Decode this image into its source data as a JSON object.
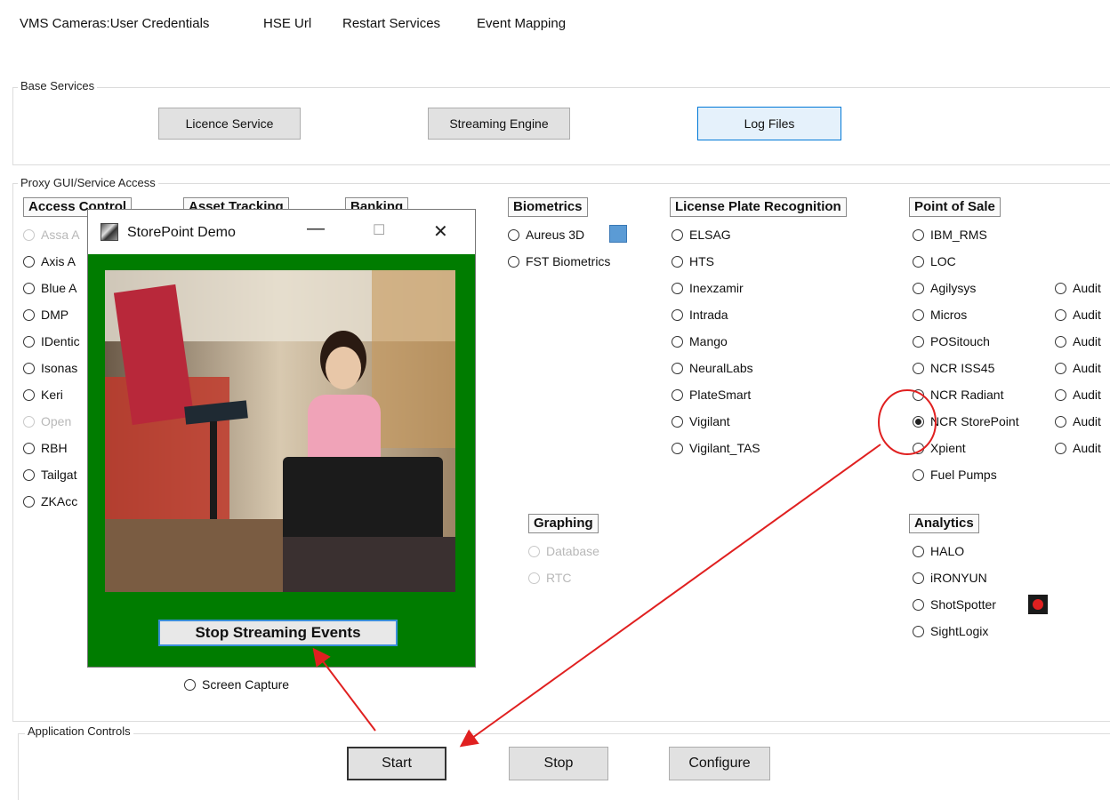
{
  "menu": [
    "VMS Cameras:User Credentials",
    "HSE Url",
    "Restart Services",
    "Event Mapping"
  ],
  "base_services": {
    "label": "Base Services",
    "buttons": [
      "Licence Service",
      "Streaming Engine",
      "Log Files"
    ]
  },
  "proxy": {
    "label": "Proxy GUI/Service Access",
    "categories": {
      "access_control": "Access Control",
      "asset_tracking": "Asset Tracking",
      "banking": "Banking",
      "biometrics": "Biometrics",
      "lpr": "License Plate Recognition",
      "pos": "Point of Sale",
      "graphing": "Graphing",
      "analytics": "Analytics"
    },
    "access_control_items": [
      "Assa A",
      "Axis A",
      "Blue A",
      "DMP",
      "IDentic",
      "Isonas",
      "Keri",
      "Open",
      "RBH",
      "Tailgat",
      "ZKAcc"
    ],
    "biometrics_items": [
      "Aureus 3D",
      "FST Biometrics"
    ],
    "lpr_items": [
      "ELSAG",
      "HTS",
      "Inexzamir",
      "Intrada",
      "Mango",
      "NeuralLabs",
      "PlateSmart",
      "Vigilant",
      "Vigilant_TAS"
    ],
    "pos_items": [
      "IBM_RMS",
      "LOC",
      "Agilysys",
      "Micros",
      "POSitouch",
      "NCR ISS45",
      "NCR Radiant",
      "NCR StorePoint",
      "Xpient",
      "Fuel Pumps"
    ],
    "pos_selected": "NCR StorePoint",
    "audit_items": [
      "Audit",
      "Audit",
      "Audit",
      "Audit",
      "Audit",
      "Audit",
      "Audit"
    ],
    "graphing_items": [
      "Database",
      "RTC"
    ],
    "analytics_items": [
      "HALO",
      "iRONYUN",
      "ShotSpotter",
      "SightLogix"
    ],
    "screen_capture": "Screen Capture"
  },
  "app_controls": {
    "label": "Application Controls",
    "buttons": [
      "Start",
      "Stop",
      "Configure"
    ]
  },
  "popup": {
    "title": "StorePoint Demo",
    "minimize": "—",
    "maximize": "☐",
    "close": "✕",
    "stop_button": "Stop Streaming Events"
  },
  "colors": {
    "popup_bg": "#007c00",
    "annotation": "#e02020",
    "focus_border": "#0078d7"
  }
}
